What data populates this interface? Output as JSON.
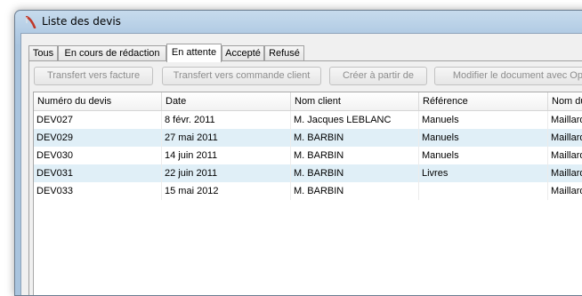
{
  "window": {
    "title": "Liste des devis",
    "icon": "app-logo-icon"
  },
  "tabs": [
    {
      "label": "Tous",
      "active": false
    },
    {
      "label": "En cours de rédaction",
      "active": false
    },
    {
      "label": "En attente",
      "active": true
    },
    {
      "label": "Accepté",
      "active": false
    },
    {
      "label": "Refusé",
      "active": false
    }
  ],
  "toolbar": {
    "transfer_invoice": "Transfert vers facture",
    "transfer_order": "Transfert vers commande client",
    "create_from": "Créer à partir de",
    "modify_document": "Modifier le document avec Open"
  },
  "table": {
    "columns": [
      "Numéro du devis",
      "Date",
      "Nom client",
      "Référence",
      "Nom du"
    ],
    "rows": [
      [
        "DEV027",
        "8 févr. 2011",
        "M. Jacques LEBLANC",
        "Manuels",
        "Maillard"
      ],
      [
        "DEV029",
        "27 mai 2011",
        "M. BARBIN",
        "Manuels",
        "Maillard"
      ],
      [
        "DEV030",
        "14 juin 2011",
        "M. BARBIN",
        "Manuels",
        "Maillard"
      ],
      [
        "DEV031",
        "22 juin 2011",
        "M. BARBIN",
        "Livres",
        "Maillard"
      ],
      [
        "DEV033",
        "15 mai 2012",
        "M. BARBIN",
        "",
        "Maillard"
      ]
    ]
  },
  "colors": {
    "row_alt": "#e0eff7",
    "disabled_text": "#8d8d8d",
    "title_bar": "#b4cde5"
  }
}
